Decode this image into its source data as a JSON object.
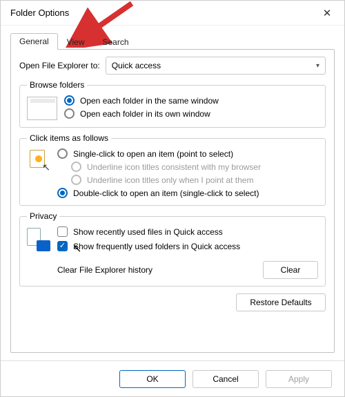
{
  "title": "Folder Options",
  "tabs": {
    "general": "General",
    "view": "View",
    "search": "Search"
  },
  "open_to": {
    "label": "Open File Explorer to:",
    "value": "Quick access"
  },
  "browse_folders": {
    "legend": "Browse folders",
    "same_window": "Open each folder in the same window",
    "own_window": "Open each folder in its own window"
  },
  "click_items": {
    "legend": "Click items as follows",
    "single": "Single-click to open an item (point to select)",
    "underline_browser": "Underline icon titles consistent with my browser",
    "underline_point": "Underline icon titles only when I point at them",
    "double": "Double-click to open an item (single-click to select)"
  },
  "privacy": {
    "legend": "Privacy",
    "recent_files": "Show recently used files in Quick access",
    "freq_folders": "Show frequently used folders in Quick access",
    "history_label": "Clear File Explorer history",
    "clear_btn": "Clear"
  },
  "restore_defaults": "Restore Defaults",
  "buttons": {
    "ok": "OK",
    "cancel": "Cancel",
    "apply": "Apply"
  }
}
